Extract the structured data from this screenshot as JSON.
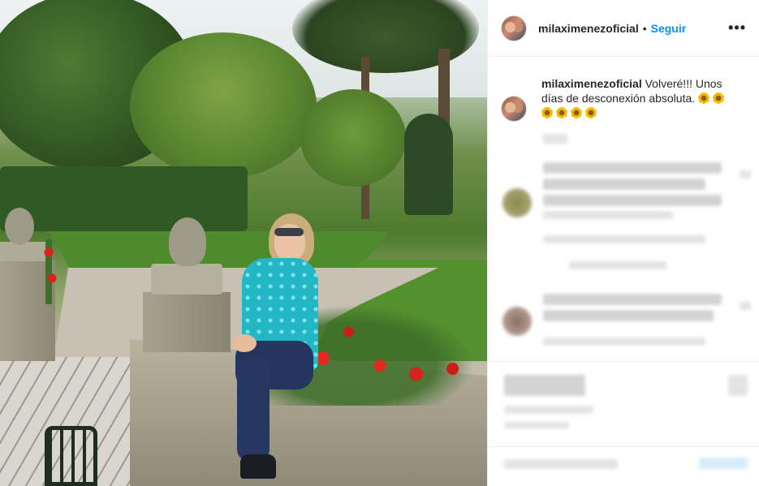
{
  "post": {
    "photo": {
      "alt_subject": "",
      "colors": {
        "sky": "#e4ebec",
        "foliage": "#4e7a2e",
        "blouse": "#23b7c6",
        "flowers": "#d8231c",
        "stone": "#b9b29e"
      }
    },
    "header": {
      "username": "milaximenezoficial",
      "separator": "•",
      "follow_label": "Seguir",
      "more_label": "•••"
    },
    "caption": {
      "username": "milaximenezoficial",
      "text": "Volveré!!! Unos días de desconexión absoluta.",
      "emoji": [
        "sunflower-icon",
        "sunflower-icon",
        "sun-icon",
        "sun-icon",
        "sun-icon",
        "sun-icon"
      ]
    },
    "colors": {
      "accent": "#0095f6",
      "text": "#262626",
      "border": "#efefef"
    }
  }
}
